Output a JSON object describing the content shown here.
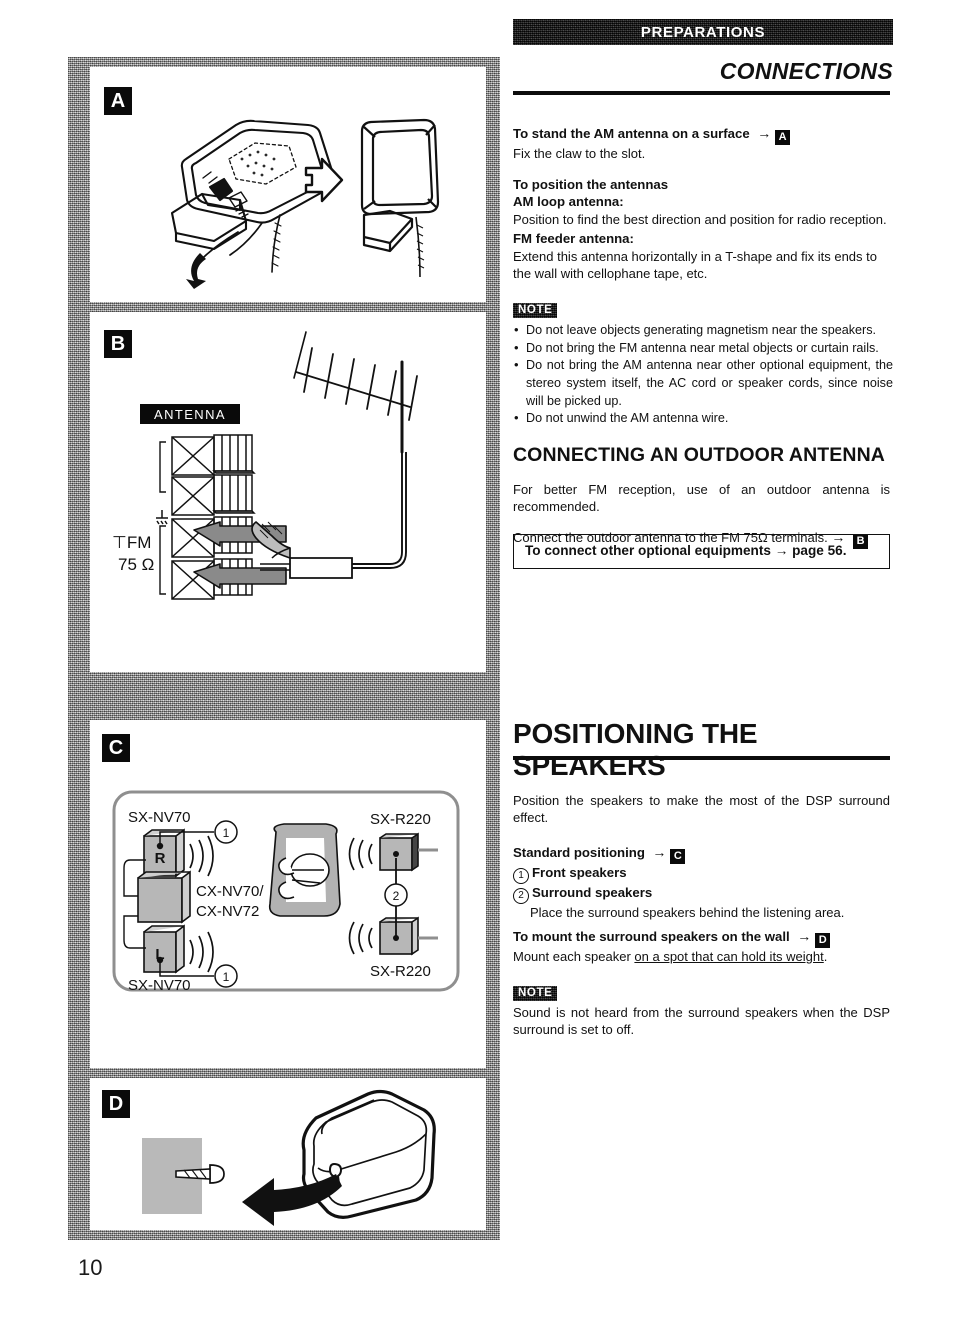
{
  "page": {
    "number": "10"
  },
  "header": {
    "band_label": "PREPARATIONS",
    "section_title": "CONNECTIONS"
  },
  "connections": {
    "stand_heading": "To stand the AM antenna on a surface",
    "stand_ref": "A",
    "stand_body": "Fix the claw to the slot.",
    "position_heading": "To position the antennas",
    "am_label": "AM loop antenna:",
    "am_body": "Position to find the best direction and position for radio reception.",
    "fm_label": "FM feeder antenna:",
    "fm_body": "Extend this antenna horizontally in a T-shape and fix its ends to the wall with cellophane tape, etc.",
    "note_badge": "NOTE",
    "notes": [
      "Do not leave objects generating magnetism near the speakers.",
      "Do not bring the FM antenna near metal objects or curtain rails.",
      "Do not bring the AM antenna near other optional equipment, the stereo system itself, the AC cord or speaker cords, since noise will be picked up.",
      "Do not unwind the AM antenna wire."
    ]
  },
  "outdoor_antenna": {
    "heading": "CONNECTING AN OUTDOOR ANTENNA",
    "body": "For better FM reception, use of an outdoor antenna is recommended.",
    "connect_line_pre": "Connect the outdoor antenna to the FM 75",
    "ohm": "Ω",
    "connect_line_post": " terminals.",
    "connect_ref": "B",
    "optional_box": "To connect other optional equipments → page 56."
  },
  "speakers": {
    "heading": "POSITIONING THE SPEAKERS",
    "intro": "Position the speakers to make the most of the DSP surround effect.",
    "standard_heading": "Standard positioning",
    "standard_ref": "C",
    "item1_num": "1",
    "item1_label": "Front speakers",
    "item2_num": "2",
    "item2_label": "Surround speakers",
    "item2_body": "Place the surround speakers  behind the listening area.",
    "mount_heading": "To mount the surround speakers on the wall",
    "mount_ref": "D",
    "mount_body_pre": "Mount each speaker ",
    "mount_body_underline": "on a spot that can hold its weight",
    "mount_body_post": ".",
    "note_badge": "NOTE",
    "note_body": "Sound is not heard from the surround speakers when the DSP surround is set to off."
  },
  "figures": {
    "panel_a": {
      "letter": "A",
      "caption_semantic": "am-loop-antenna-stand-assembly"
    },
    "panel_b": {
      "letter": "B",
      "terminal_label": "ANTENNA",
      "fm_label": "FM",
      "impedance_label": "75 Ω",
      "caption_semantic": "outdoor-antenna-to-fm-terminals"
    },
    "panel_c": {
      "letter": "C",
      "front_right_model": "SX-NV70",
      "front_left_model": "SX-NV70",
      "center_model_line1": "CX-NV70/",
      "center_model_line2": "CX-NV72",
      "surround_top_model": "SX-R220",
      "surround_bottom_model": "SX-R220",
      "right_speaker_mark": "R",
      "left_speaker_mark": "L",
      "callout_front": "1",
      "callout_surround": "2"
    },
    "panel_d": {
      "letter": "D",
      "caption_semantic": "wall-mount-speaker-on-screw"
    }
  },
  "colors": {
    "ink": "#111111",
    "paper": "#ffffff",
    "scan_gray": "#aeaeae",
    "band_black": "#1b1b1b"
  }
}
